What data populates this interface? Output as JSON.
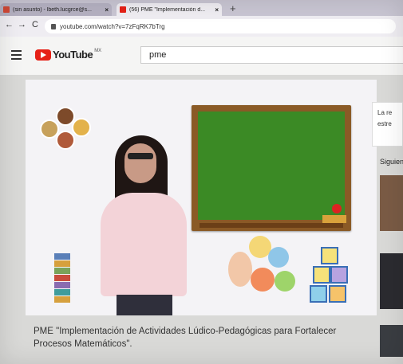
{
  "browser": {
    "tabs": [
      {
        "label": "(sin asunto) - lbeth.lucgrce@s...",
        "favicon_color": "#d14836"
      },
      {
        "label": "(56) PME \"Implementación d...",
        "favicon_color": "#e62117"
      }
    ],
    "tab_close": "×",
    "new_tab": "+",
    "back": "←",
    "forward": "→",
    "reload": "C",
    "url": "youtube.com/watch?v=7zFqRK7bTrg"
  },
  "youtube": {
    "logo_text": "YouTube",
    "country_code": "MX",
    "search_value": "pme"
  },
  "video": {
    "title_line1": "PME \"Implementación de Actividades Lúdico-Pedagógicas para Fortalecer",
    "title_line2": "Procesos Matemáticos\"."
  },
  "sidebar": {
    "box_line1": "La re",
    "box_line2": "estre",
    "up_next_label": "Siguien"
  }
}
